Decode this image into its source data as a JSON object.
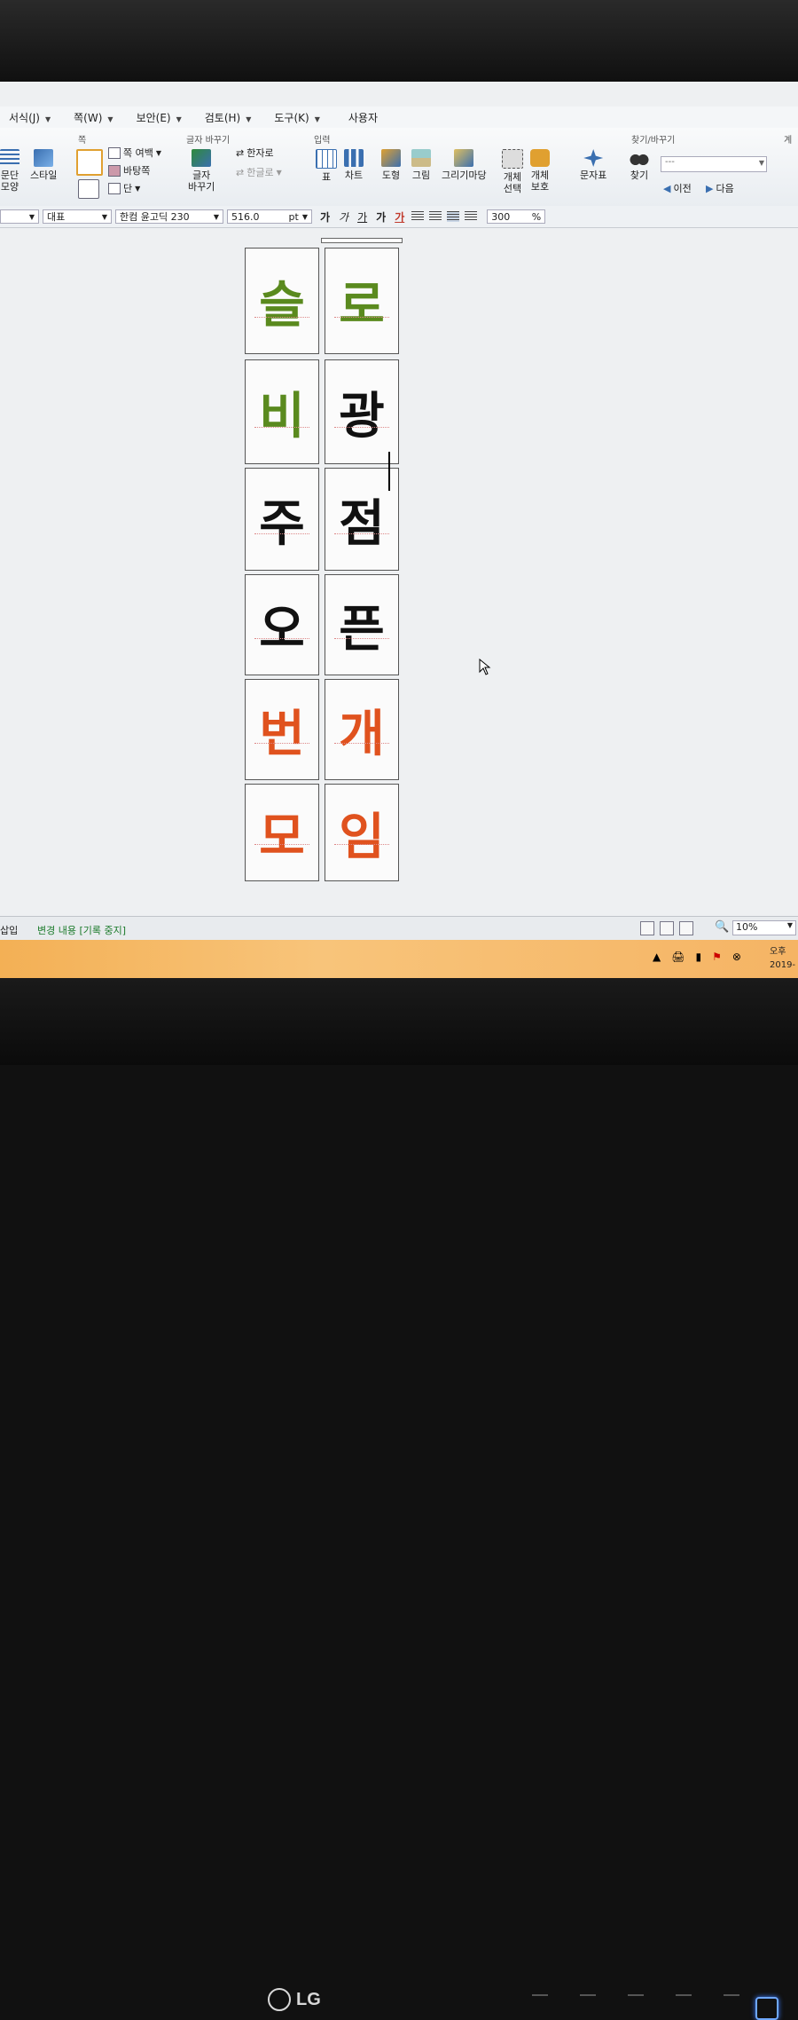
{
  "menu": [
    {
      "label": "서식(J)"
    },
    {
      "label": "쪽(W)"
    },
    {
      "label": "보안(E)"
    },
    {
      "label": "검토(H)"
    },
    {
      "label": "도구(K)"
    },
    {
      "label": "사용자"
    }
  ],
  "ribbon": {
    "group_titles": {
      "page": "쪽",
      "find_replace_glyph": "글자 바꾸기",
      "input": "입력",
      "find_replace": "찾기/바꾸기",
      "extra": "계"
    },
    "paragraph_shape": "문단\n모양",
    "style": "스타일",
    "page_margin": "쪽 여백",
    "background": "바탕쪽",
    "column": "단",
    "char_change": "글자\n바꾸기",
    "hanja": "한자로",
    "hangul": "한글로",
    "table": "표",
    "chart": "차트",
    "shape": "도형",
    "picture": "그림",
    "picture_yard": "그리기마당",
    "object_select": "개체\n선택",
    "object_protect": "개체\n보호",
    "char_table": "문자표",
    "find": "찾기",
    "find_box": "---",
    "prev": "이전",
    "next": "다음"
  },
  "format": {
    "style": "대표",
    "font": "한컴 윤고딕 230",
    "size": "516.0",
    "unit": "pt",
    "bold": "가",
    "italic": "가",
    "underline": "가",
    "strike": "가",
    "color_char": "가",
    "line_spacing": "300",
    "pct": "%"
  },
  "cells": [
    {
      "text": "슬",
      "color": "#5a8a1e"
    },
    {
      "text": "로",
      "color": "#5a8a1e"
    },
    {
      "text": "비",
      "color": "#5a8a1e"
    },
    {
      "text": "광",
      "color": "#111111"
    },
    {
      "text": "주",
      "color": "#111111"
    },
    {
      "text": "점",
      "color": "#111111"
    },
    {
      "text": "오",
      "color": "#111111"
    },
    {
      "text": "픈",
      "color": "#111111"
    },
    {
      "text": "번",
      "color": "#e0521e"
    },
    {
      "text": "개",
      "color": "#e0521e"
    },
    {
      "text": "모",
      "color": "#e0521e"
    },
    {
      "text": "임",
      "color": "#e0521e"
    }
  ],
  "status": {
    "mode": "삽입",
    "track": "변경 내용 [기록 중지]",
    "zoom": "10%"
  },
  "taskbar": {
    "clock_line1": "오후",
    "clock_line2": "2019-"
  },
  "monitor": {
    "brand": "LG"
  }
}
